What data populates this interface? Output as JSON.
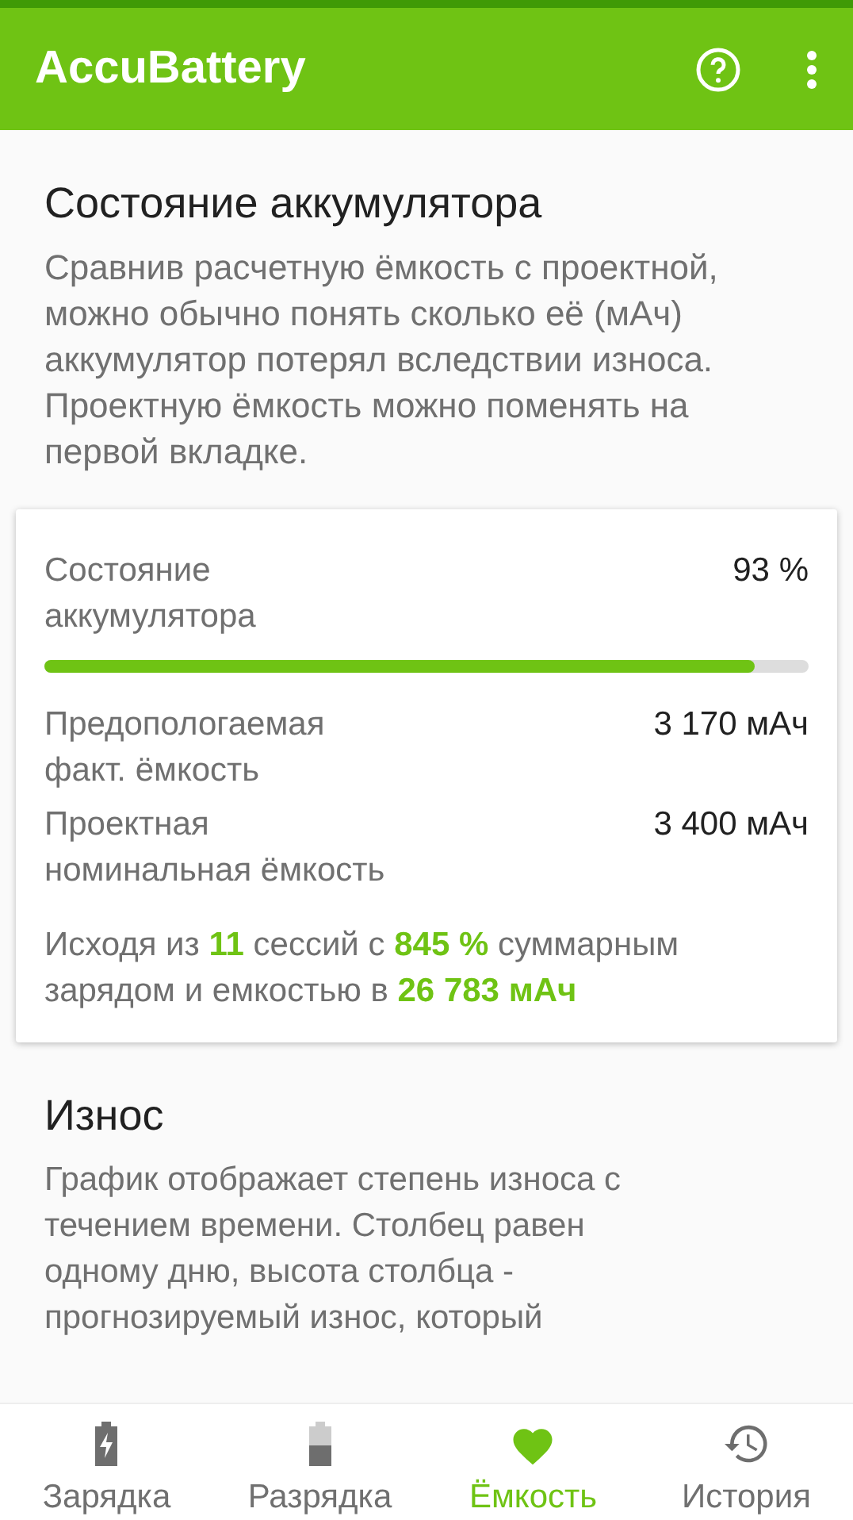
{
  "app_bar": {
    "title": "AccuBattery"
  },
  "health_section": {
    "title": "Состояние аккумулятора",
    "description": "Сравнив расчетную ёмкость с проектной, можно обычно понять сколько её (мАч) аккумулятор потерял вследствии износа. Проектную ёмкость можно поменять на первой вкладке."
  },
  "health_card": {
    "label": "Состояние аккумулятора",
    "value": "93 %",
    "level": 0.93,
    "rows": [
      {
        "label": "Предопологаемая факт. ёмкость",
        "value": "3 170 мАч"
      },
      {
        "label": "Проектная номинальная ёмкость",
        "value": "3 400 мАч"
      }
    ],
    "summary": "Исходя из **11** сессий с **845 %** суммарным зарядом и емкостью в **26 783 мАч**"
  },
  "wear_section": {
    "title": "Износ",
    "description": "График отображает степень износа с течением времени. Столбец равен одному дню, высота столбца - прогнозируемый износ, который"
  },
  "bottom_nav": [
    {
      "label": "Зарядка",
      "selected": false
    },
    {
      "label": "Разрядка",
      "selected": false
    },
    {
      "label": "Ёмкость",
      "selected": true
    },
    {
      "label": "История",
      "selected": false
    }
  ]
}
